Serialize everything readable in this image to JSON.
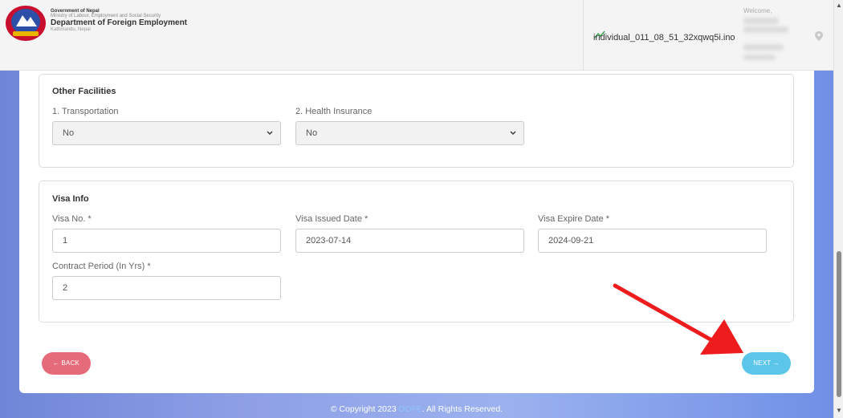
{
  "header": {
    "gov_line1": "Government of Nepal",
    "gov_line2": "Ministry of Labour, Employment and Social Security",
    "dept": "Department of Foreign Employment",
    "location": "Kathmandu, Nepal",
    "welcome": "Welcome,",
    "username": "individual_011_08_51_32xqwq5i.ino"
  },
  "other_facilities": {
    "title": "Other Facilities",
    "transportation_label": "1. Transportation",
    "transportation_value": "No",
    "health_label": "2. Health Insurance",
    "health_value": "No"
  },
  "visa_info": {
    "title": "Visa Info",
    "visa_no_label": "Visa No. *",
    "visa_no_value": "1",
    "issued_label": "Visa Issued Date *",
    "issued_value": "2023-07-14",
    "expire_label": "Visa Expire Date *",
    "expire_value": "2024-09-21",
    "contract_label": "Contract Period (In Yrs) *",
    "contract_value": "2"
  },
  "buttons": {
    "back": "← BACK",
    "next": "NEXT →"
  },
  "footer": {
    "prefix": "© Copyright 2023 ",
    "org": "DOFE",
    "suffix": ". All Rights Reserved."
  },
  "colors": {
    "back_button": "#e56b7a",
    "next_button": "#5bc5ea",
    "annotation_arrow": "#ee1c1c"
  }
}
